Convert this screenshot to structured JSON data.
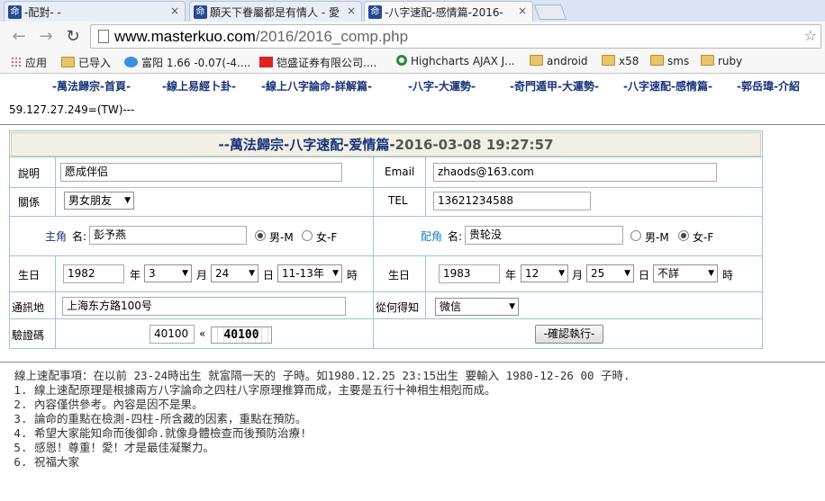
{
  "browser": {
    "tabs": [
      {
        "label": "-配對- -"
      },
      {
        "label": "願天下眷屬都是有情人 - 愛"
      },
      {
        "label": "-八字速配-感情篇-2016-"
      }
    ],
    "favicon": "命",
    "close_glyph": "×",
    "url_host": "www.masterkuo.com",
    "url_path": "/2016/2016_comp.php",
    "bookmarks": [
      {
        "label": "应用",
        "icon": "apps-icon"
      },
      {
        "label": "已导入",
        "icon": "folder-icon"
      },
      {
        "label": "富阳 1.66 -0.07(-4....",
        "icon": "stock-icon"
      },
      {
        "label": "铠盛证券有限公司....",
        "icon": "bookmark-icon"
      },
      {
        "label": "Highcharts AJAX J...",
        "icon": "highcharts-icon"
      },
      {
        "label": "android",
        "icon": "folder-icon"
      },
      {
        "label": "x58",
        "icon": "folder-icon"
      },
      {
        "label": "sms",
        "icon": "folder-icon"
      },
      {
        "label": "ruby",
        "icon": "folder-icon"
      }
    ]
  },
  "nav": [
    "-萬法歸宗-首頁-",
    "-線上易經卜卦-",
    "-線上八字論命-詳解篇-",
    "-八字-大運勢-",
    "-奇門遁甲-大運勢-",
    "-八字速配-感情篇-",
    "-郭岳瑋-介紹"
  ],
  "ip_line": "59.127.27.249=(TW)---",
  "form": {
    "title_prefix": "--萬法歸宗-八字速配-爱情篇-",
    "timestamp": "2016-03-08 19:27:57",
    "desc_label": "說明",
    "desc_value": "愿成伴侣",
    "email_label": "Email",
    "email_value": "zhaods@163.com",
    "relation_label": "關係",
    "relation_value": "男女朋友",
    "tel_label": "TEL",
    "tel_value": "13621234588",
    "main_role": "主角",
    "partner_role": "配角",
    "name_label": "名:",
    "main_name": "彭予燕",
    "partner_name": "贵轮没",
    "male": "男-M",
    "female": "女-F",
    "main_gender": "male",
    "partner_gender": "female",
    "birth_label": "生日",
    "year_unit": "年",
    "month_unit": "月",
    "day_unit": "日",
    "hour_unit": "時",
    "main_year": "1982",
    "main_month": "3",
    "main_day": "24",
    "main_hour": "11-13年",
    "partner_year": "1983",
    "partner_month": "12",
    "partner_day": "25",
    "partner_hour": "不詳",
    "address_label": "通訊地",
    "address_value": "上海东方路100号",
    "source_label": "從何得知",
    "source_value": "微信",
    "captcha_label": "驗證碼",
    "captcha_input": "40100",
    "captcha_quote": "«",
    "captcha_image_text": "40100",
    "submit_label": "-確認執行-"
  },
  "notes": {
    "heading": "線上速配事項：在以前 23-24時出生 就富隔一天的 子時。如1980.12.25 23:15出生 要輸入 1980-12-26 00 子時.",
    "items": [
      "線上速配原理是根據兩方八字論命之四柱八字原理推算而成，主要是五行十神相生相剋而成。",
      "內容僅供參考。內容是因不是果。",
      "論命的重點在檢測-四柱-所含藏的因素，重點在預防。",
      "希望大家能知命而後御命.就像身體檢查而後預防治療!",
      "感恩！尊重！愛！才是最佳凝聚力。",
      "祝福大家"
    ]
  }
}
